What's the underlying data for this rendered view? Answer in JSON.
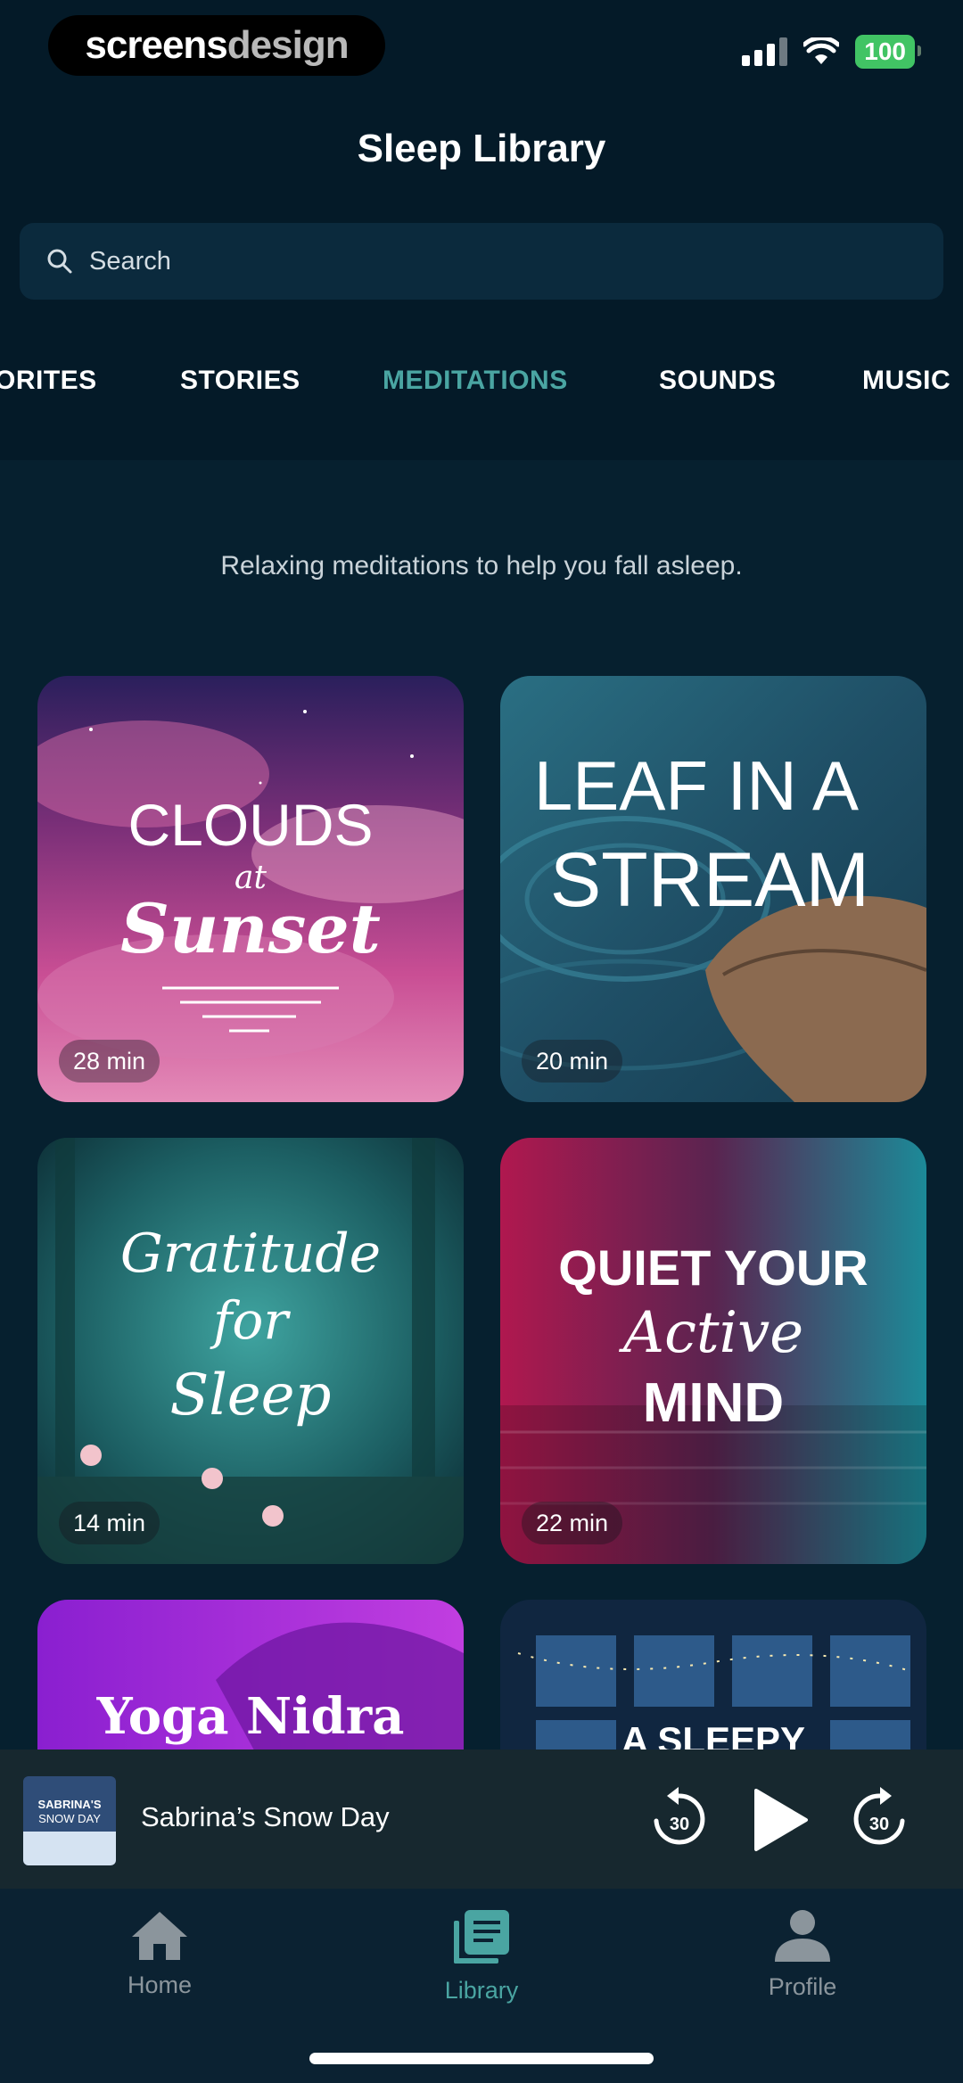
{
  "status_bar": {
    "brand_part1": "screens",
    "brand_part2": "design",
    "battery": "100"
  },
  "header": {
    "title": "Sleep Library"
  },
  "search": {
    "placeholder": "Search"
  },
  "tabs": [
    {
      "label": "ORITES",
      "active": false
    },
    {
      "label": "STORIES",
      "active": false
    },
    {
      "label": "MEDITATIONS",
      "active": true
    },
    {
      "label": "SOUNDS",
      "active": false
    },
    {
      "label": "MUSIC",
      "active": false
    }
  ],
  "section": {
    "subtitle": "Relaxing meditations to help you fall asleep."
  },
  "cards": [
    {
      "title_line1": "CLOUDS",
      "title_line2": "at",
      "title_line3": "Sunset",
      "duration": "28 min"
    },
    {
      "title_line1": "LEAF IN A",
      "title_line2": "STREAM",
      "duration": "20 min"
    },
    {
      "title_line1": "Gratitude",
      "title_line2": "for",
      "title_line3": "Sleep",
      "duration": "14 min"
    },
    {
      "title_line1": "QUIET YOUR",
      "title_line2": "Active",
      "title_line3": "MIND",
      "duration": "22 min"
    },
    {
      "title_line1": "Yoga Nidra"
    },
    {
      "title_line1": "A SLEEPY"
    }
  ],
  "player": {
    "art_text_line1": "SABRINA'S",
    "art_text_line2": "SNOW DAY",
    "title": "Sabrina’s Snow Day",
    "skip_back": "30",
    "skip_forward": "30"
  },
  "tabbar": {
    "items": [
      {
        "label": "Home",
        "icon": "home-icon",
        "active": false
      },
      {
        "label": "Library",
        "icon": "library-icon",
        "active": true
      },
      {
        "label": "Profile",
        "icon": "profile-icon",
        "active": false
      }
    ]
  },
  "colors": {
    "accent": "#4aa5a2",
    "background": "#06202f",
    "battery": "#41c464"
  }
}
